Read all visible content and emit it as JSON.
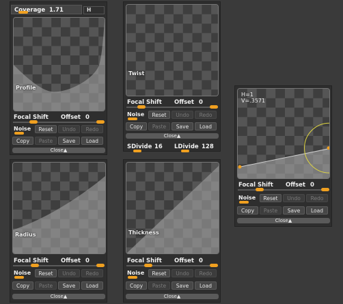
{
  "coverage": {
    "label": "Coverage",
    "value": "1.71",
    "h_button": "H"
  },
  "common": {
    "focal_shift": "Focal Shift",
    "offset": "Offset",
    "noise": "Noise",
    "reset": "Reset",
    "undo": "Undo",
    "redo": "Redo",
    "copy": "Copy",
    "paste": "Paste",
    "save": "Save",
    "load": "Load",
    "close": "Close",
    "close_arrow": "▲"
  },
  "panels": {
    "profile": {
      "label": "Profile",
      "focal_value": "0",
      "offset_value": "0"
    },
    "twist": {
      "label": "Twist",
      "focal_value": "0",
      "offset_value": "0"
    },
    "radius": {
      "label": "Radius",
      "focal_value": "0",
      "offset_value": "0"
    },
    "thickness": {
      "label": "Thickness",
      "focal_value": "0",
      "offset_value": "0"
    },
    "graph": {
      "h_readout": "H=1",
      "v_readout": "V=.3571",
      "focal_value": "0",
      "offset_value": "0"
    }
  },
  "divide": {
    "sdivide_label": "SDivide",
    "sdivide_value": "16",
    "ldivide_label": "LDivide",
    "ldivide_value": "128"
  },
  "colors": {
    "accent": "#f0a020",
    "panel_bg": "#2e2e2e",
    "curve_fill": "#a9a9a9",
    "highlight_circle": "#e0d640"
  }
}
